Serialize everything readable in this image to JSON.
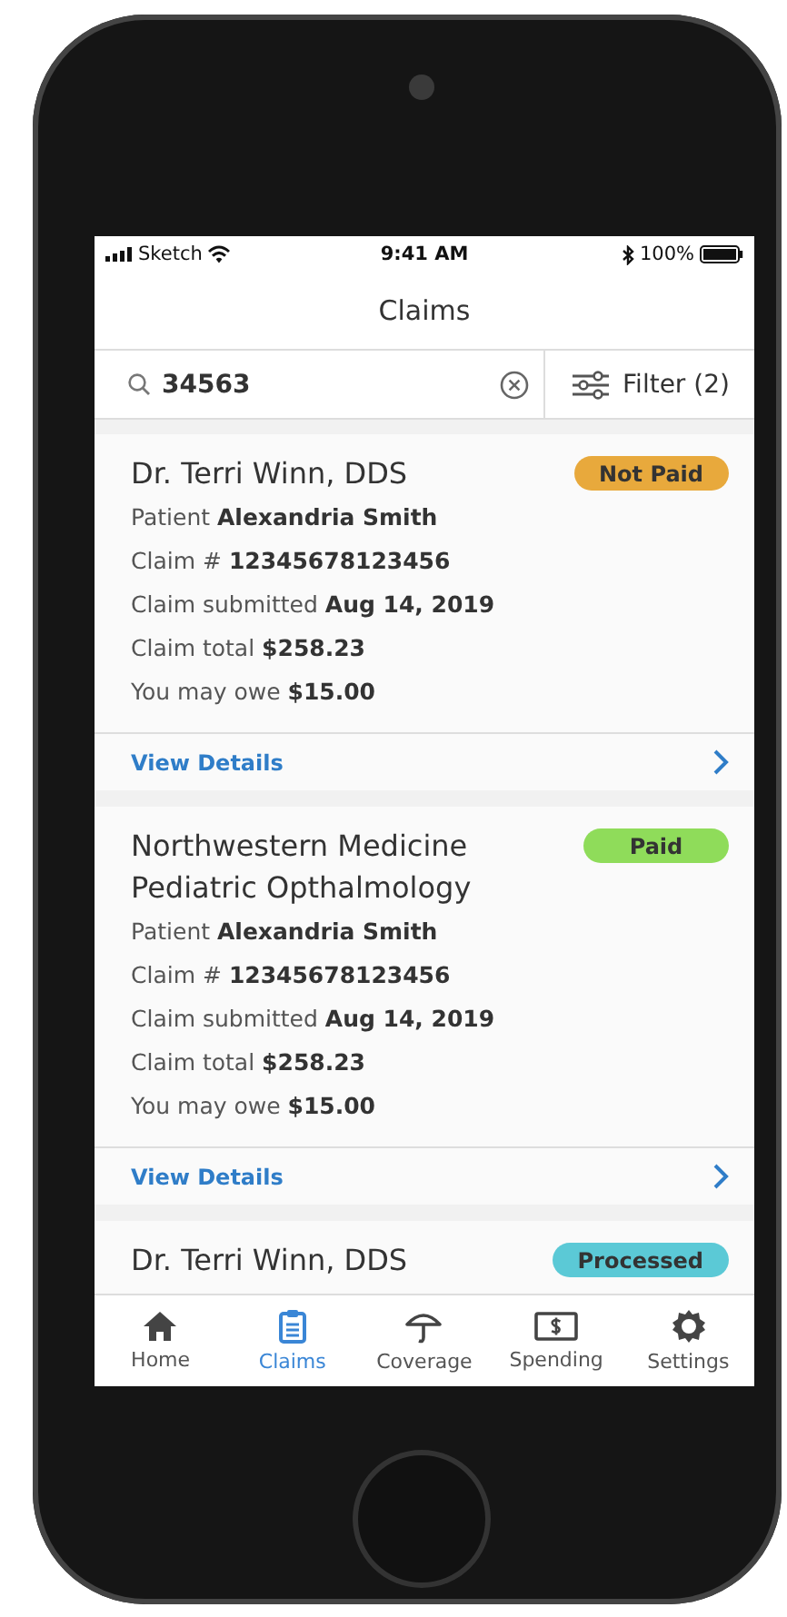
{
  "status_bar": {
    "carrier": "Sketch",
    "time": "9:41 AM",
    "battery": "100%"
  },
  "header": {
    "title": "Claims"
  },
  "search": {
    "value": "34563"
  },
  "filter": {
    "label": "Filter (2)"
  },
  "claims": [
    {
      "provider": "Dr. Terri Winn, DDS",
      "status": "Not Paid",
      "color": "#e8a93c",
      "details": [
        "Patient **Alexandria Smith**",
        "Claim # **12345678123456**",
        "Claim submitted **Aug 14, 2019**",
        "Claim total **$258.23**",
        "You may owe **$15.00**"
      ],
      "link": "View Details"
    },
    {
      "provider": "Northwestern Medicine Pediatric Opthalmology",
      "status": "Paid",
      "color": "#8fdc5a",
      "details": [
        "Patient **Alexandria Smith**",
        "Claim # **12345678123456**",
        "Claim submitted **Aug 14, 2019**",
        "Claim total **$258.23**",
        "You may owe **$15.00**"
      ],
      "link": "View Details"
    },
    {
      "provider": "Dr. Terri Winn, DDS",
      "status": "Processed",
      "color": "#5bc9d6"
    }
  ],
  "nav": [
    {
      "kind": "home",
      "label": "Home",
      "selected": false
    },
    {
      "kind": "claims",
      "label": "Claims",
      "selected": true
    },
    {
      "kind": "coverage",
      "label": "Coverage",
      "selected": false
    },
    {
      "kind": "spending",
      "label": "Spending",
      "selected": false
    },
    {
      "kind": "settings",
      "label": "Settings",
      "selected": false
    }
  ]
}
